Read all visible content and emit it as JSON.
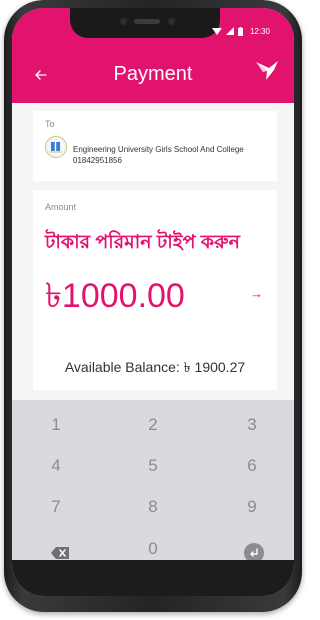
{
  "status_bar": {
    "time": "12:30"
  },
  "header": {
    "title": "Payment",
    "back_icon": "back-arrow-icon",
    "logo_icon": "bird-logo-icon"
  },
  "recipient": {
    "label": "To",
    "name": "Engineering University Girls School And College",
    "number": "01842951856"
  },
  "amount": {
    "label": "Amount",
    "instruction_bn": "টাকার পরিমান টাইপ করুন",
    "value": "৳1000.00",
    "next_icon": "arrow-right-icon",
    "balance_text": "Available Balance: ৳ 1900.27"
  },
  "keypad": {
    "keys": [
      "1",
      "2",
      "3",
      "4",
      "5",
      "6",
      "7",
      "8",
      "9",
      "0"
    ],
    "backspace_icon": "backspace-icon",
    "enter_icon": "enter-icon"
  },
  "colors": {
    "brand": "#e2136e",
    "keypad_bg": "#d9d9de",
    "key_text": "#8b8b92"
  }
}
